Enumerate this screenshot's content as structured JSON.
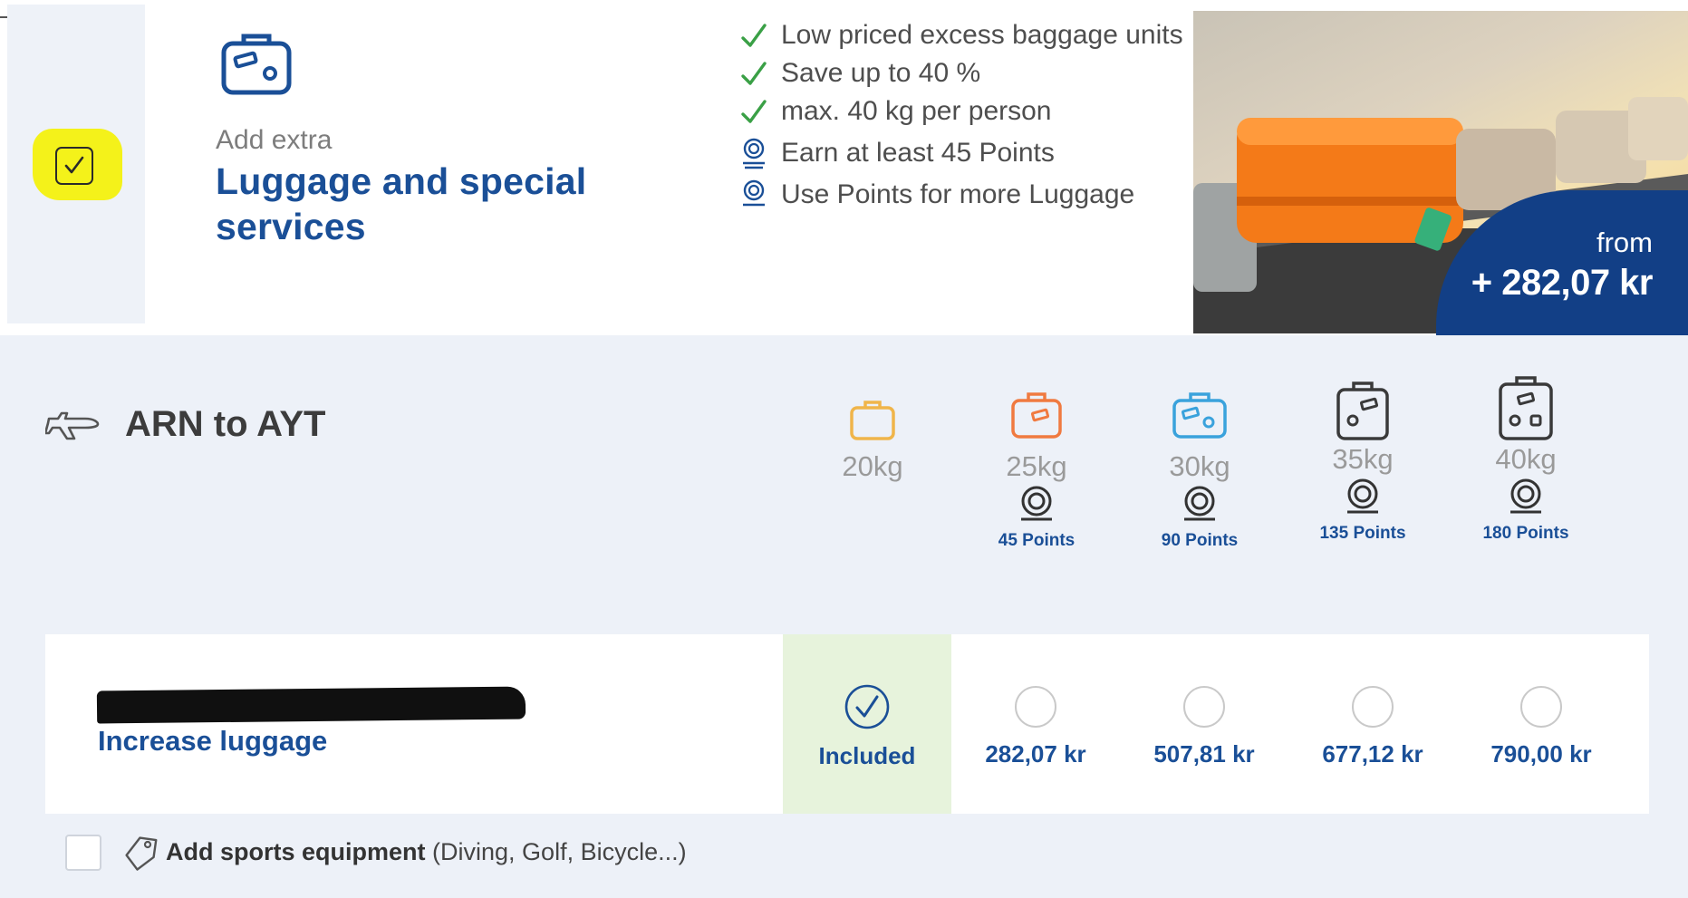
{
  "header": {
    "add_extra": "Add extra",
    "title": "Luggage and special services",
    "features": [
      {
        "icon": "check-icon",
        "text": "Low priced excess baggage units"
      },
      {
        "icon": "check-icon",
        "text": "Save up to 40 %"
      },
      {
        "icon": "check-icon",
        "text": "max. 40 kg per person"
      },
      {
        "icon": "points-icon",
        "text": "Earn at least 45 Points"
      },
      {
        "icon": "points-icon",
        "text": "Use Points for more Luggage"
      }
    ],
    "price_from": "from",
    "price": "+ 282,07 kr",
    "selected": true
  },
  "route": {
    "label": "ARN to AYT",
    "icon": "plane-icon"
  },
  "options": [
    {
      "weight": "20kg",
      "points": "",
      "price": "Included",
      "selected": true,
      "color": "#f0b54a"
    },
    {
      "weight": "25kg",
      "points": "45 Points",
      "price": "282,07 kr",
      "selected": false,
      "color": "#f07a40"
    },
    {
      "weight": "30kg",
      "points": "90 Points",
      "price": "507,81 kr",
      "selected": false,
      "color": "#3aa2dc"
    },
    {
      "weight": "35kg",
      "points": "135 Points",
      "price": "677,12 kr",
      "selected": false,
      "color": "#3a3a3a"
    },
    {
      "weight": "40kg",
      "points": "180 Points",
      "price": "790,00 kr",
      "selected": false,
      "color": "#3a3a3a"
    }
  ],
  "passenger": {
    "action": "Increase luggage"
  },
  "sports": {
    "label": "Add sports equipment",
    "detail": "(Diving, Golf, Bicycle...)",
    "checked": false
  },
  "colors": {
    "brand_blue": "#1a4f97",
    "badge_navy": "#123f86",
    "check_green": "#3aa046",
    "included_bg": "#e7f3dc",
    "panel_bg": "#edf1f8",
    "highlight": "#f4f21a"
  }
}
